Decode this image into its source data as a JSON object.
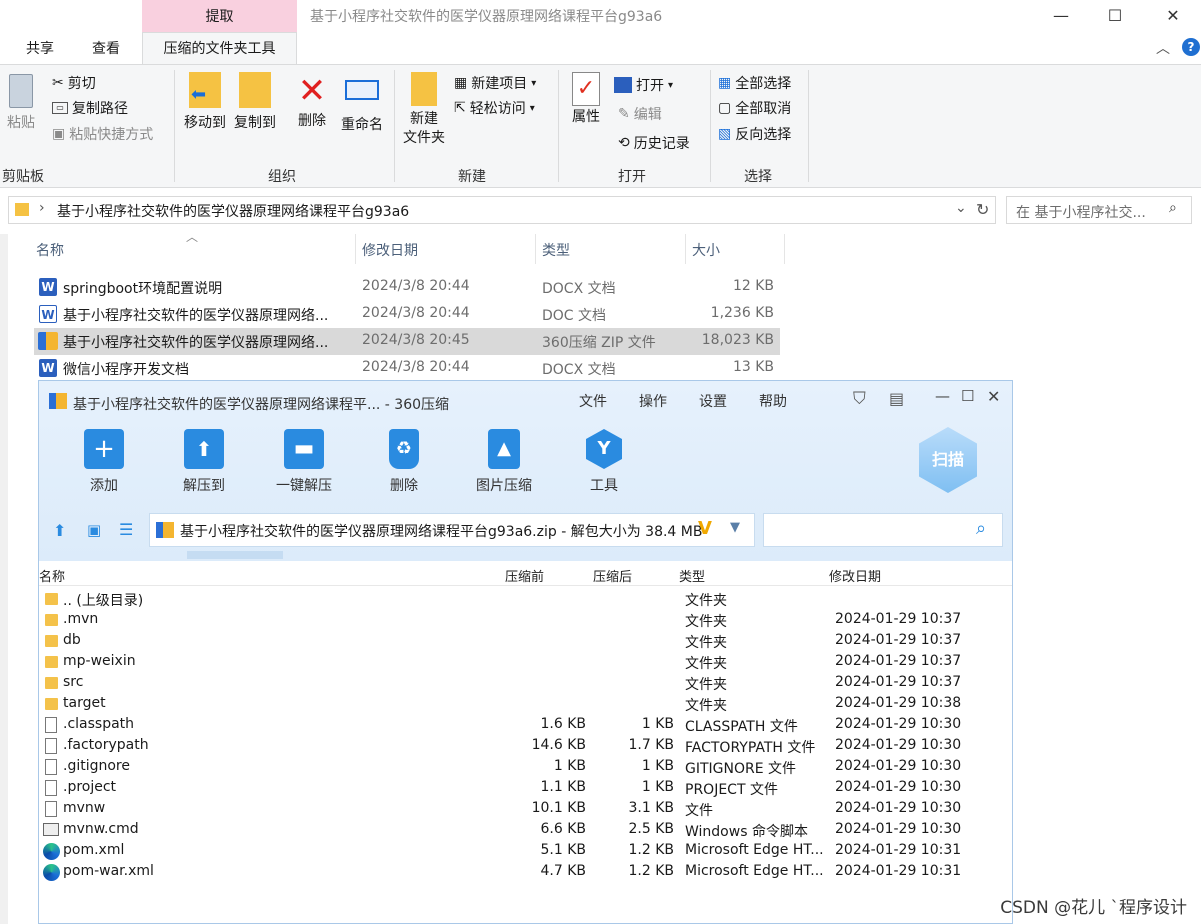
{
  "explorer": {
    "window_title": "基于小程序社交软件的医学仪器原理网络课程平台g93a6",
    "context_tab_header": "提取",
    "ribbon_tabs": [
      "共享",
      "查看",
      "压缩的文件夹工具"
    ],
    "groups": {
      "clipboard": {
        "label": "剪贴板",
        "paste": "粘贴",
        "cut": "剪切",
        "copy_path": "复制路径",
        "paste_shortcut": "粘贴快捷方式"
      },
      "organize": {
        "label": "组织",
        "move_to": "移动到",
        "copy_to": "复制到",
        "delete": "删除",
        "rename": "重命名"
      },
      "new": {
        "label": "新建",
        "new_folder": "新建\n文件夹",
        "new_item": "新建项目",
        "easy_access": "轻松访问"
      },
      "open": {
        "label": "打开",
        "properties": "属性",
        "open": "打开",
        "edit": "编辑",
        "history": "历史记录"
      },
      "select": {
        "label": "选择",
        "select_all": "全部选择",
        "select_none": "全部取消",
        "invert": "反向选择"
      }
    },
    "address": "基于小程序社交软件的医学仪器原理网络课程平台g93a6",
    "search_placeholder": "在 基于小程序社交...",
    "columns": {
      "name": "名称",
      "date": "修改日期",
      "type": "类型",
      "size": "大小"
    },
    "files": [
      {
        "name": "springboot环境配置说明",
        "date": "2024/3/8 20:44",
        "type": "DOCX 文档",
        "size": "12 KB",
        "icon": "word-icon"
      },
      {
        "name": "基于小程序社交软件的医学仪器原理网络...",
        "date": "2024/3/8 20:44",
        "type": "DOC 文档",
        "size": "1,236 KB",
        "icon": "word-icon"
      },
      {
        "name": "基于小程序社交软件的医学仪器原理网络...",
        "date": "2024/3/8 20:45",
        "type": "360压缩 ZIP 文件",
        "size": "18,023 KB",
        "icon": "zip-icon"
      },
      {
        "name": "微信小程序开发文档",
        "date": "2024/3/8 20:44",
        "type": "DOCX 文档",
        "size": "13 KB",
        "icon": "word-icon"
      }
    ]
  },
  "zip": {
    "title": "基于小程序社交软件的医学仪器原理网络课程平... - 360压缩",
    "menu": [
      "文件",
      "操作",
      "设置",
      "帮助"
    ],
    "tools": [
      "添加",
      "解压到",
      "一键解压",
      "删除",
      "图片压缩",
      "工具"
    ],
    "scan_label": "扫描",
    "path": "基于小程序社交软件的医学仪器原理网络课程平台g93a6.zip - 解包大小为 38.4 MB",
    "columns": {
      "name": "名称",
      "before": "压缩前",
      "after": "压缩后",
      "type": "类型",
      "date": "修改日期"
    },
    "rows": [
      {
        "name": ".. (上级目录)",
        "before": "",
        "after": "",
        "type": "文件夹",
        "date": "",
        "icon": "folder"
      },
      {
        "name": ".mvn",
        "before": "",
        "after": "",
        "type": "文件夹",
        "date": "2024-01-29 10:37",
        "icon": "folder"
      },
      {
        "name": "db",
        "before": "",
        "after": "",
        "type": "文件夹",
        "date": "2024-01-29 10:37",
        "icon": "folder"
      },
      {
        "name": "mp-weixin",
        "before": "",
        "after": "",
        "type": "文件夹",
        "date": "2024-01-29 10:37",
        "icon": "folder"
      },
      {
        "name": "src",
        "before": "",
        "after": "",
        "type": "文件夹",
        "date": "2024-01-29 10:37",
        "icon": "folder"
      },
      {
        "name": "target",
        "before": "",
        "after": "",
        "type": "文件夹",
        "date": "2024-01-29 10:38",
        "icon": "folder"
      },
      {
        "name": ".classpath",
        "before": "1.6 KB",
        "after": "1 KB",
        "type": "CLASSPATH 文件",
        "date": "2024-01-29 10:30",
        "icon": "file"
      },
      {
        "name": ".factorypath",
        "before": "14.6 KB",
        "after": "1.7 KB",
        "type": "FACTORYPATH 文件",
        "date": "2024-01-29 10:30",
        "icon": "file"
      },
      {
        "name": ".gitignore",
        "before": "1 KB",
        "after": "1 KB",
        "type": "GITIGNORE 文件",
        "date": "2024-01-29 10:30",
        "icon": "file"
      },
      {
        "name": ".project",
        "before": "1.1 KB",
        "after": "1 KB",
        "type": "PROJECT 文件",
        "date": "2024-01-29 10:30",
        "icon": "file"
      },
      {
        "name": "mvnw",
        "before": "10.1 KB",
        "after": "3.1 KB",
        "type": "文件",
        "date": "2024-01-29 10:30",
        "icon": "file"
      },
      {
        "name": "mvnw.cmd",
        "before": "6.6 KB",
        "after": "2.5 KB",
        "type": "Windows 命令脚本",
        "date": "2024-01-29 10:30",
        "icon": "cmd"
      },
      {
        "name": "pom.xml",
        "before": "5.1 KB",
        "after": "1.2 KB",
        "type": "Microsoft Edge HT...",
        "date": "2024-01-29 10:31",
        "icon": "edge"
      },
      {
        "name": "pom-war.xml",
        "before": "4.7 KB",
        "after": "1.2 KB",
        "type": "Microsoft Edge HT...",
        "date": "2024-01-29 10:31",
        "icon": "edge"
      }
    ]
  },
  "watermark": "CSDN @花儿 `程序设计"
}
